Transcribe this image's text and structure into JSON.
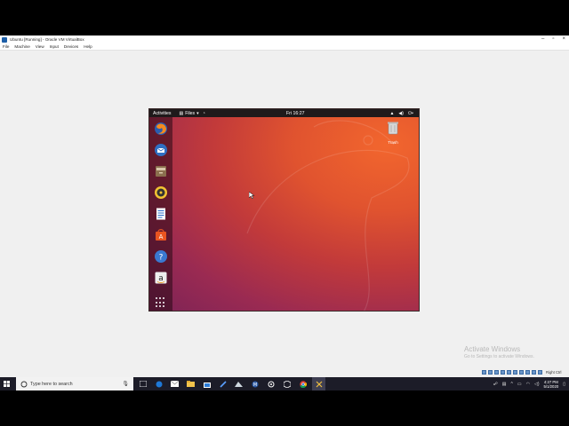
{
  "window": {
    "title": "Ubuntu [Running] - Oracle VM VirtualBox",
    "controls": [
      "–",
      "▫",
      "×"
    ]
  },
  "menubar": {
    "items": [
      "File",
      "Machine",
      "View",
      "Input",
      "Devices",
      "Help"
    ]
  },
  "ubuntu": {
    "topbar": {
      "activities": "Activities",
      "app_menu": "Files",
      "app_menu_arrow": "▾",
      "clock": "Fri 16:27"
    },
    "dock_icons": [
      "firefox-icon",
      "thunderbird-icon",
      "files-icon",
      "rhythmbox-icon",
      "writer-icon",
      "software-center-icon",
      "help-icon",
      "amazon-icon",
      "show-applications-icon"
    ],
    "desktop": {
      "trash_label": "Trash"
    }
  },
  "windows_overlay": {
    "activate_title": "Activate Windows",
    "activate_subtitle": "Go to Settings to activate Windows.",
    "vbox_host_key": "Right Ctrl"
  },
  "taskbar": {
    "search_placeholder": "Type here to search",
    "clock_time": "4:27 PM",
    "clock_date": "5/1/2020"
  },
  "colors": {
    "ubuntu_orange": "#e95420",
    "ubuntu_aubergine": "#77216f",
    "taskbar": "#1c1c28"
  }
}
